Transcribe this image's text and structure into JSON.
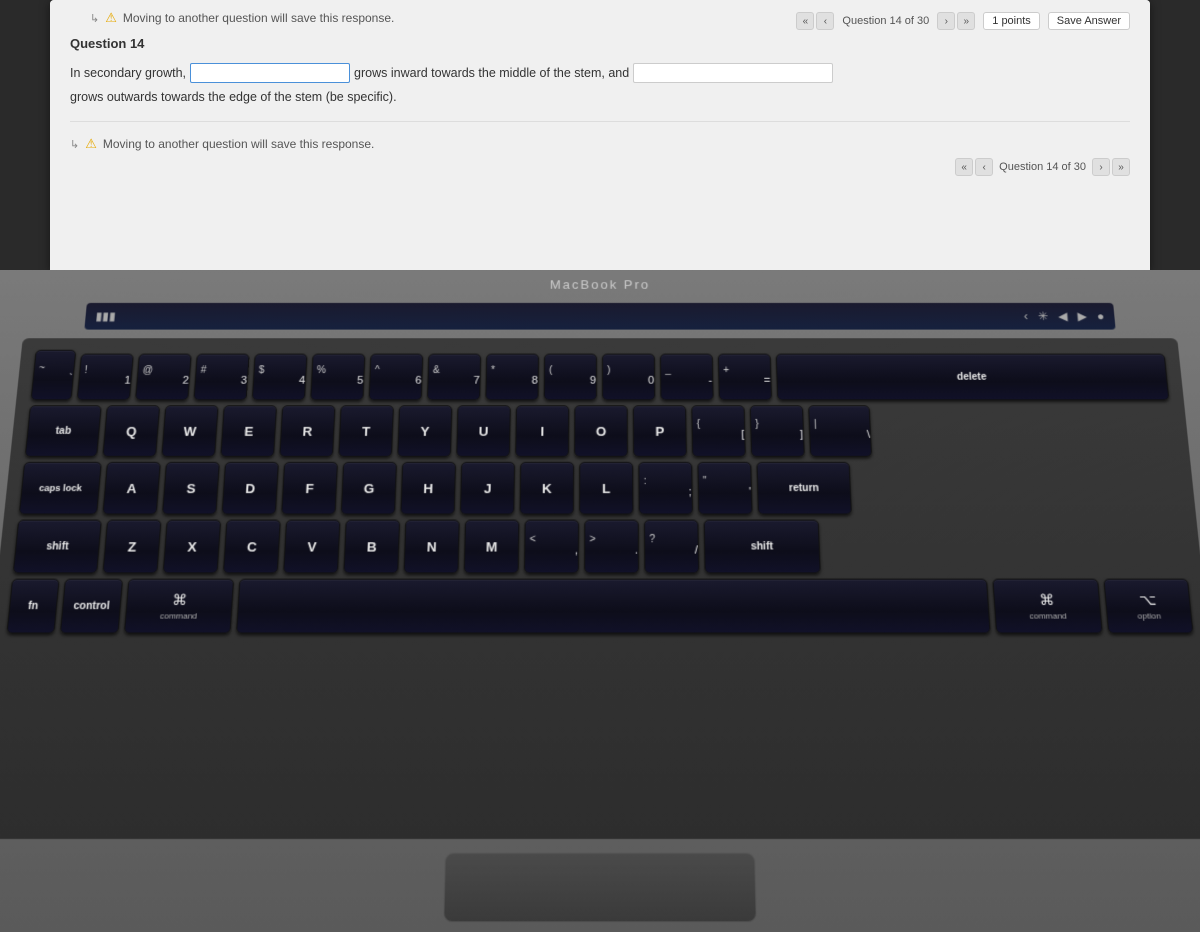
{
  "screen": {
    "warning_top": "Moving to another question will save this response.",
    "question_counter": "Question 14 of 30",
    "points": "1 points",
    "save_button": "Save Answer",
    "question_title": "Question 14",
    "question_text_before": "In secondary growth,",
    "question_text_middle": "grows inward towards the middle of the stem, and",
    "question_text_after": "grows outwards towards the edge of the stem (be specific).",
    "warning_bottom": "Moving to another question will save this response.",
    "question_counter_bottom": "Question 14 of 30"
  },
  "laptop": {
    "brand": "MacBook Pro"
  },
  "touchbar": {
    "icons": [
      "battery-icon",
      "chevron-left-icon",
      "brightness-icon",
      "volume-icon",
      "mute-icon",
      "color-icon"
    ]
  },
  "keyboard": {
    "rows": [
      {
        "id": "number-row",
        "keys": [
          {
            "id": "key-1",
            "top": "!",
            "bottom": "1"
          },
          {
            "id": "key-2",
            "top": "@",
            "bottom": "2"
          },
          {
            "id": "key-3",
            "top": "#",
            "bottom": "3"
          },
          {
            "id": "key-4",
            "top": "$",
            "bottom": "4"
          },
          {
            "id": "key-5",
            "top": "%",
            "bottom": "5"
          },
          {
            "id": "key-6",
            "top": "^",
            "bottom": "6"
          },
          {
            "id": "key-7",
            "top": "&",
            "bottom": "7"
          },
          {
            "id": "key-8",
            "top": "*",
            "bottom": "8"
          },
          {
            "id": "key-9",
            "top": "(",
            "bottom": "9"
          },
          {
            "id": "key-0",
            "top": ")",
            "bottom": "0"
          },
          {
            "id": "key-minus",
            "top": "_",
            "bottom": "-"
          },
          {
            "id": "key-equals",
            "top": "+",
            "bottom": "="
          }
        ]
      }
    ],
    "qwerty_row": [
      "Q",
      "W",
      "E",
      "R",
      "T",
      "Y",
      "U",
      "I",
      "O",
      "P"
    ],
    "asdf_row": [
      "A",
      "S",
      "D",
      "F",
      "G",
      "H",
      "J",
      "K",
      "L"
    ],
    "zxcv_row": [
      "Z",
      "X",
      "C",
      "V",
      "B",
      "N",
      "M"
    ],
    "bottom_labels": {
      "command_left": "command",
      "command_right": "command",
      "option": "option",
      "cmd_symbol": "⌘",
      "option_symbol": "⌥"
    }
  }
}
